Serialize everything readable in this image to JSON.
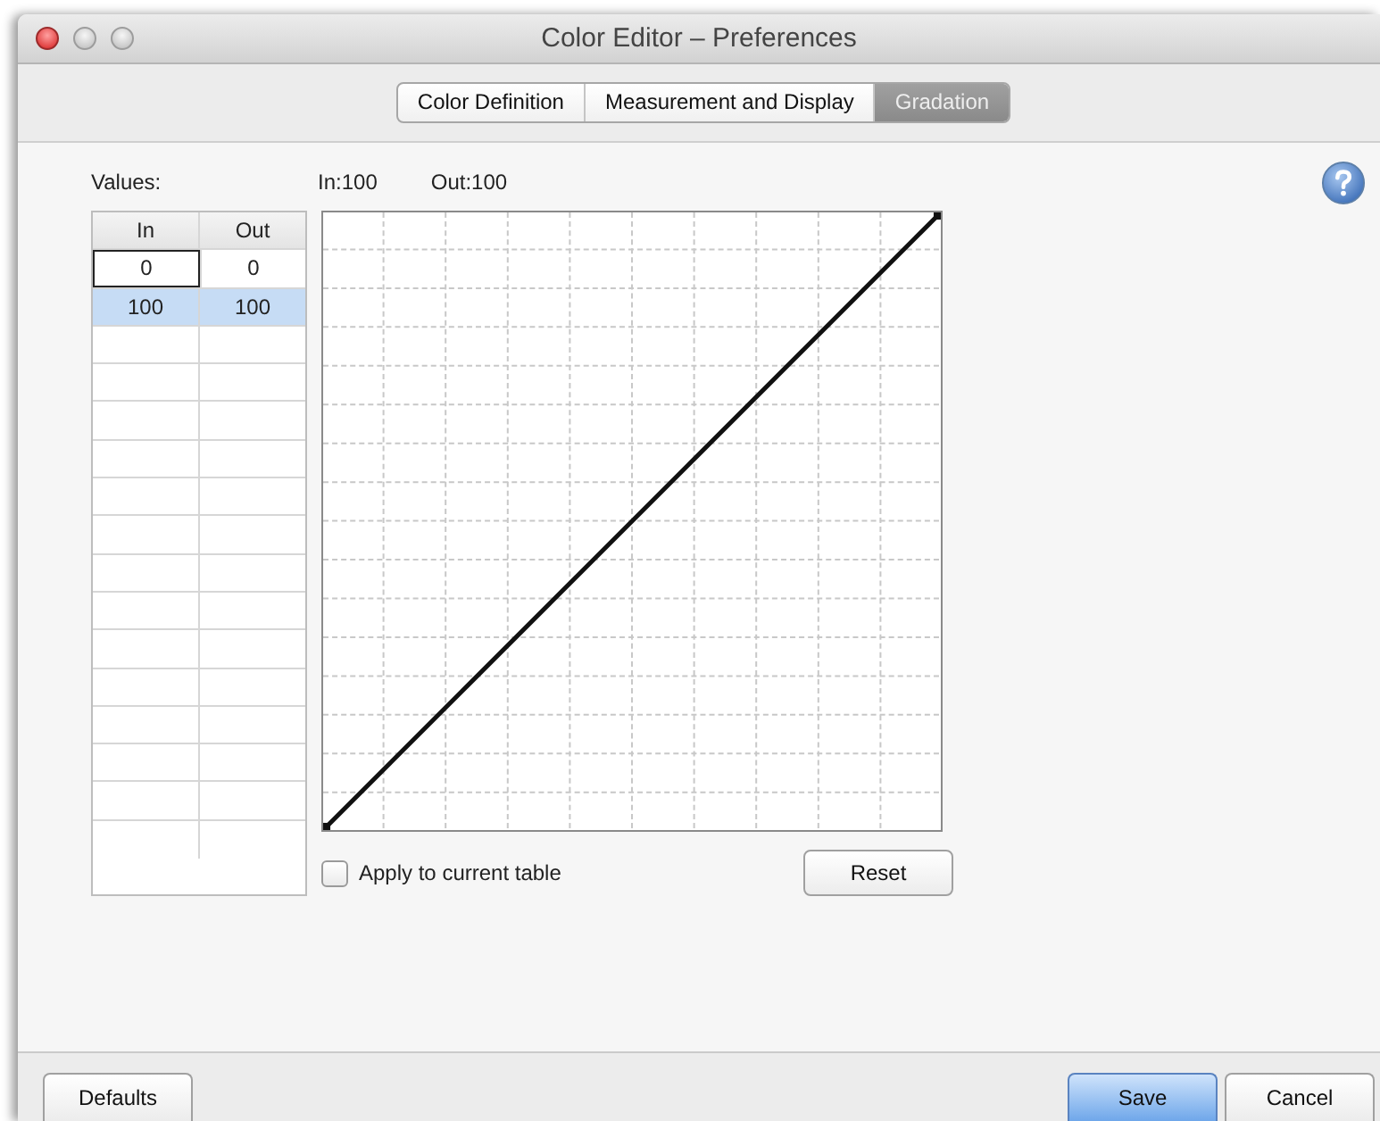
{
  "window": {
    "title": "Color Editor – Preferences"
  },
  "tabs": [
    {
      "label": "Color Definition",
      "selected": false
    },
    {
      "label": "Measurement and Display",
      "selected": false
    },
    {
      "label": "Gradation",
      "selected": true
    }
  ],
  "values_label": "Values:",
  "readout": {
    "in": "In:100",
    "out": "Out:100"
  },
  "table": {
    "columns": [
      "In",
      "Out"
    ],
    "rows": [
      {
        "in": "0",
        "out": "0",
        "selected": false,
        "editing": true
      },
      {
        "in": "100",
        "out": "100",
        "selected": true,
        "editing": false
      }
    ]
  },
  "apply_checkbox": {
    "label": "Apply to current table",
    "checked": false
  },
  "reset_button": "Reset",
  "buttons": [
    {
      "label": "Defaults",
      "kind": "normal"
    },
    {
      "label": "Save",
      "kind": "default"
    },
    {
      "label": "Cancel",
      "kind": "normal"
    }
  ]
}
